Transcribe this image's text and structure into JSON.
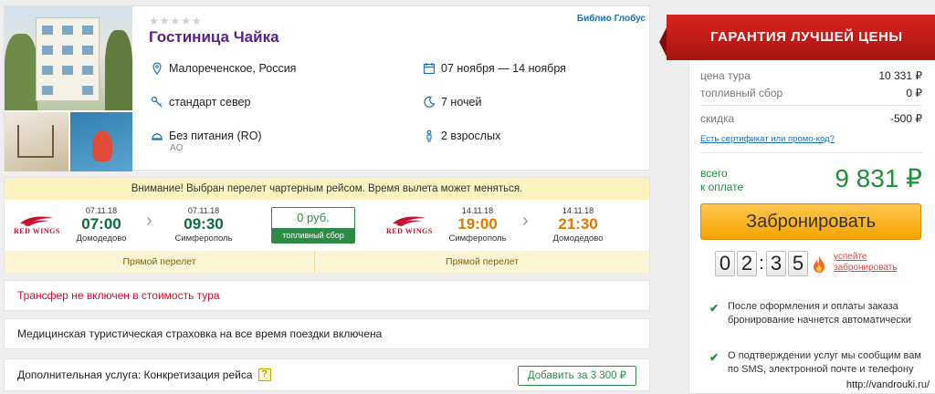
{
  "hotel": {
    "stars": "★★★★★",
    "operator": "Библио Глобус",
    "name": "Гостиница Чайка",
    "location": "Малореченское, Россия",
    "room": "стандарт север",
    "meal": "Без питания (RO)",
    "meal_code": "AO",
    "dates": "07 ноября — 14 ноября",
    "nights": "7 ночей",
    "guests": "2 взрослых"
  },
  "flight": {
    "notice": "Внимание! Выбран перелет чартерным рейсом. Время вылета может меняться.",
    "airline": "RED WINGS",
    "outbound": {
      "dep_date": "07.11.18",
      "dep_time": "07:00",
      "dep_city": "Домодедово",
      "arr_date": "07.11.18",
      "arr_time": "09:30",
      "arr_city": "Симферополь",
      "direct": "Прямой перелет"
    },
    "fuel": {
      "price": "0 руб.",
      "label": "топливный сбор"
    },
    "inbound": {
      "dep_date": "14.11.18",
      "dep_time": "19:00",
      "dep_city": "Симферополь",
      "arr_date": "14.11.18",
      "arr_time": "21:30",
      "arr_city": "Домодедово",
      "direct": "Прямой перелет"
    }
  },
  "transfer": "Трансфер не включен в стоимость тура",
  "insurance": "Медицинская туристическая страховка на все время поездки включена",
  "extra": {
    "label": "Дополнительная услуга: Конкретизация рейса",
    "hint": "?",
    "add_button": "Добавить за 3 300 ₽"
  },
  "price": {
    "guarantee": "ГАРАНТИЯ ЛУЧШЕЙ ЦЕНЫ",
    "tour_label": "цена тура",
    "tour_value": "10 331 ₽",
    "fuel_label": "топливный сбор",
    "fuel_value": "0 ₽",
    "discount_label": "скидка",
    "discount_value": "-500 ₽",
    "cert_link": "Есть сертификат или промо-код?",
    "total_label_1": "всего",
    "total_label_2": "к оплате",
    "total_value": "9 831 ₽",
    "book_button": "Забронировать",
    "timer_digits": [
      "0",
      "2",
      "3",
      "5"
    ],
    "hurry_1": "успейте",
    "hurry_2": "забронировать",
    "bullet_1": "После оформления и оплаты заказа бронирование начнется автоматически",
    "bullet_2": "О подтверждении услуг мы сообщим вам по SMS, электронной почте и телефону"
  },
  "watermark": "http://vandrouki.ru/",
  "colors": {
    "accent_green": "#1e8f3a",
    "title_purple": "#5a1f8a",
    "book_orange": "#f5a300",
    "ribbon_red": "#c8102e"
  }
}
